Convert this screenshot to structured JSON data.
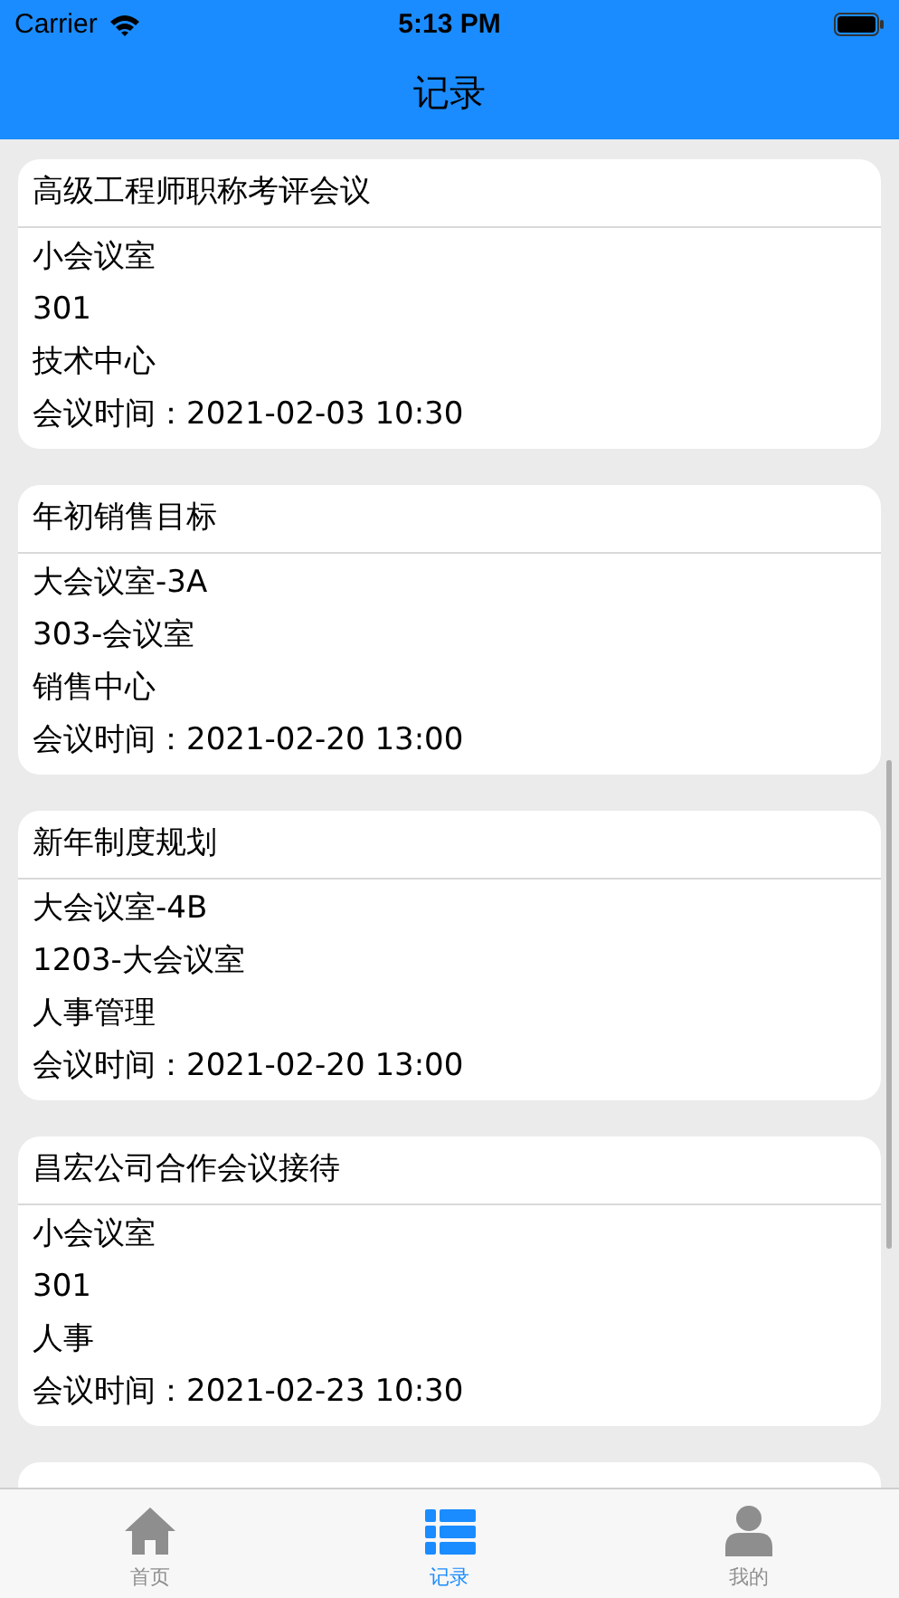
{
  "status_bar": {
    "carrier": "Carrier",
    "time": "5:13 PM"
  },
  "nav_bar": {
    "title": "记录"
  },
  "records": [
    {
      "title": "高级工程师职称考评会议",
      "lines": [
        "小会议室",
        "301",
        "技术中心",
        "会议时间：2021-02-03 10:30"
      ]
    },
    {
      "title": "年初销售目标",
      "lines": [
        "大会议室-3A",
        "303-会议室",
        "销售中心",
        "会议时间：2021-02-20 13:00"
      ]
    },
    {
      "title": "新年制度规划",
      "lines": [
        "大会议室-4B",
        "1203-大会议室",
        "人事管理",
        "会议时间：2021-02-20 13:00"
      ]
    },
    {
      "title": "昌宏公司合作会议接待",
      "lines": [
        "小会议室",
        "301",
        "人事",
        "会议时间：2021-02-23 10:30"
      ]
    }
  ],
  "tab_bar": [
    {
      "label": "首页",
      "kind": "home",
      "selected": false
    },
    {
      "label": "记录",
      "kind": "list",
      "selected": true
    },
    {
      "label": "我的",
      "kind": "person",
      "selected": false
    }
  ]
}
